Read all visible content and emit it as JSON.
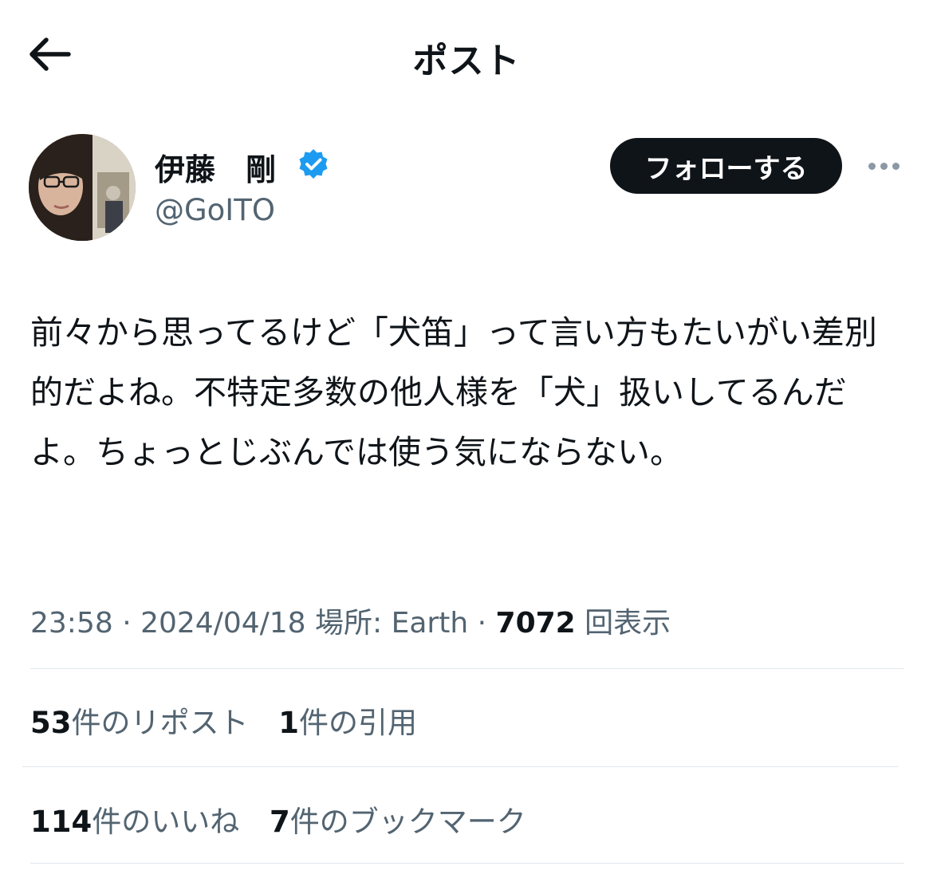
{
  "header": {
    "title": "ポスト",
    "back_icon": "arrow-left-icon"
  },
  "author": {
    "display_name": "伊藤　剛",
    "handle": "@GoITO",
    "verified_icon": "verified-badge-icon",
    "verified_color": "#1d9bf0"
  },
  "actions": {
    "follow_label": "フォローする",
    "more_icon": "more-horizontal-icon"
  },
  "tweet": {
    "text": "前々から思ってるけど「犬笛」って言い方もたいがい差別的だよね。不特定多数の他人様を「犬」扱いしてるんだよ。ちょっとじぶんでは使う気にならない。"
  },
  "meta": {
    "time": "23:58",
    "sep1": " · ",
    "date": "2024/04/18",
    "location": "場所: Earth",
    "sep2": " · ",
    "views_count": "7072",
    "views_label": "回表示"
  },
  "stats": {
    "reposts_count": "53",
    "reposts_label": "件のリポスト",
    "quotes_count": "1",
    "quotes_label": "件の引用",
    "likes_count": "114",
    "likes_label": "件のいいね",
    "bookmarks_count": "7",
    "bookmarks_label": "件のブックマーク"
  },
  "colors": {
    "text_primary": "#0f1419",
    "text_secondary": "#536471",
    "button_dark": "#0f1419"
  }
}
